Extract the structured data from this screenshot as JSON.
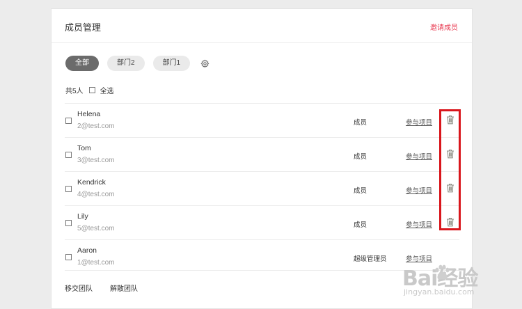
{
  "header": {
    "title": "成员管理",
    "invite_label": "邀请成员"
  },
  "filters": [
    {
      "label": "全部",
      "active": true
    },
    {
      "label": "部门2",
      "active": false
    },
    {
      "label": "部门1",
      "active": false
    }
  ],
  "summary": {
    "count_label": "共5人",
    "select_all_label": "全选"
  },
  "members": [
    {
      "name": "Helena",
      "email": "2@test.com",
      "role": "成员",
      "projects_label": "参与项目",
      "deletable": true
    },
    {
      "name": "Tom",
      "email": "3@test.com",
      "role": "成员",
      "projects_label": "参与项目",
      "deletable": true
    },
    {
      "name": "Kendrick",
      "email": "4@test.com",
      "role": "成员",
      "projects_label": "参与项目",
      "deletable": true
    },
    {
      "name": "Lily",
      "email": "5@test.com",
      "role": "成员",
      "projects_label": "参与项目",
      "deletable": true
    },
    {
      "name": "Aaron",
      "email": "1@test.com",
      "role": "超级管理员",
      "projects_label": "参与项目",
      "deletable": false
    }
  ],
  "footer": {
    "transfer_label": "移交团队",
    "dissolve_label": "解散团队"
  },
  "watermark": {
    "text": "Bai经验",
    "url": "jingyan.baidu.com"
  },
  "colors": {
    "accent": "#e8384f",
    "highlight": "#d9161c",
    "active_pill": "#6b6b6b"
  },
  "icons": {
    "settings": "gear-icon",
    "delete": "trash-icon"
  }
}
